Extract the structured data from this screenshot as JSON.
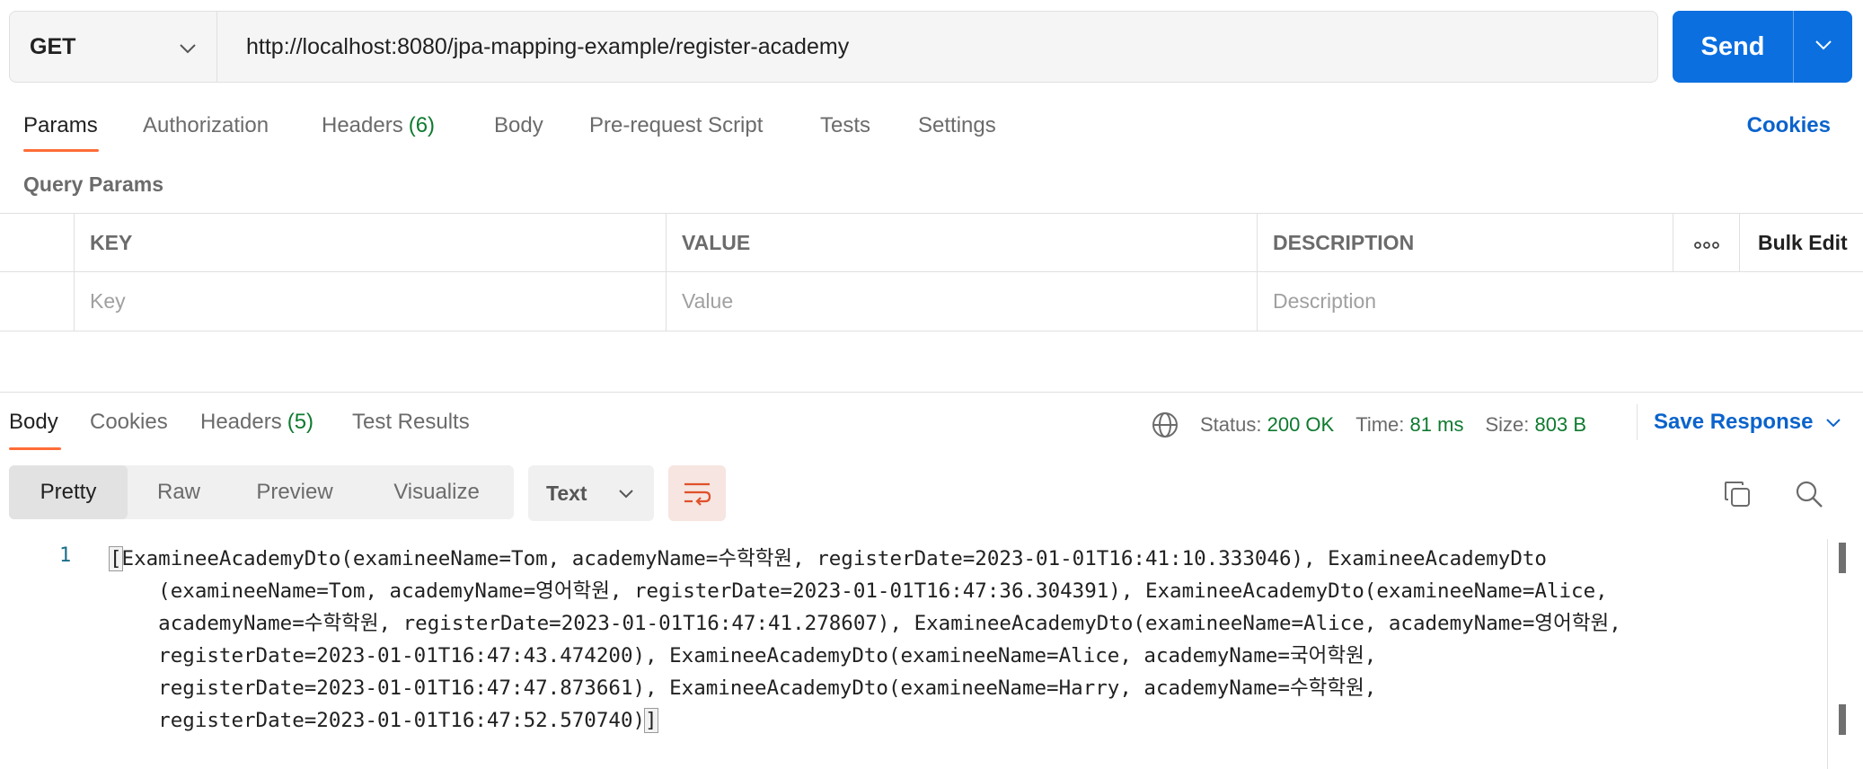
{
  "request": {
    "method": "GET",
    "url": "http://localhost:8080/jpa-mapping-example/register-academy",
    "send_label": "Send"
  },
  "request_tabs": {
    "params": "Params",
    "authorization": "Authorization",
    "headers": "Headers",
    "headers_count": "(6)",
    "body": "Body",
    "pre_request": "Pre-request Script",
    "tests": "Tests",
    "settings": "Settings",
    "active": "Params",
    "cookies": "Cookies"
  },
  "query_params": {
    "title": "Query Params",
    "columns": {
      "key": "KEY",
      "value": "VALUE",
      "description": "DESCRIPTION"
    },
    "more_icon": "more-horizontal-icon",
    "bulk_edit": "Bulk Edit",
    "placeholders": {
      "key": "Key",
      "value": "Value",
      "description": "Description"
    }
  },
  "response_tabs": {
    "body": "Body",
    "cookies": "Cookies",
    "headers": "Headers",
    "headers_count": "(5)",
    "test_results": "Test Results",
    "active": "Body"
  },
  "response_meta": {
    "globe_icon": "globe-icon",
    "status_label": "Status:",
    "status_value": "200 OK",
    "time_label": "Time:",
    "time_value": "81 ms",
    "size_label": "Size:",
    "size_value": "803 B",
    "save_response": "Save Response"
  },
  "view_modes": {
    "pretty": "Pretty",
    "raw": "Raw",
    "preview": "Preview",
    "visualize": "Visualize",
    "active": "Pretty",
    "format": "Text"
  },
  "response_body": {
    "line_number": "1",
    "open_bracket": "[",
    "close_bracket": "]",
    "lines": [
      "ExamineeAcademyDto(examineeName=Tom, academyName=수학학원, registerDate=2023-01-01T16:41:10.333046), ExamineeAcademyDto",
      "    (examineeName=Tom, academyName=영어학원, registerDate=2023-01-01T16:47:36.304391), ExamineeAcademyDto(examineeName=Alice,",
      "    academyName=수학학원, registerDate=2023-01-01T16:47:41.278607), ExamineeAcademyDto(examineeName=Alice, academyName=영어학원,",
      "    registerDate=2023-01-01T16:47:43.474200), ExamineeAcademyDto(examineeName=Alice, academyName=국어학원,",
      "    registerDate=2023-01-01T16:47:47.873661), ExamineeAcademyDto(examineeName=Harry, academyName=수학학원,",
      "    registerDate=2023-01-01T16:47:52.570740)"
    ]
  },
  "colors": {
    "send_blue": "#0b6fe0",
    "active_tab_orange": "#ff6c37",
    "count_green": "#0e7a2f",
    "link_blue": "#0b63cc"
  }
}
